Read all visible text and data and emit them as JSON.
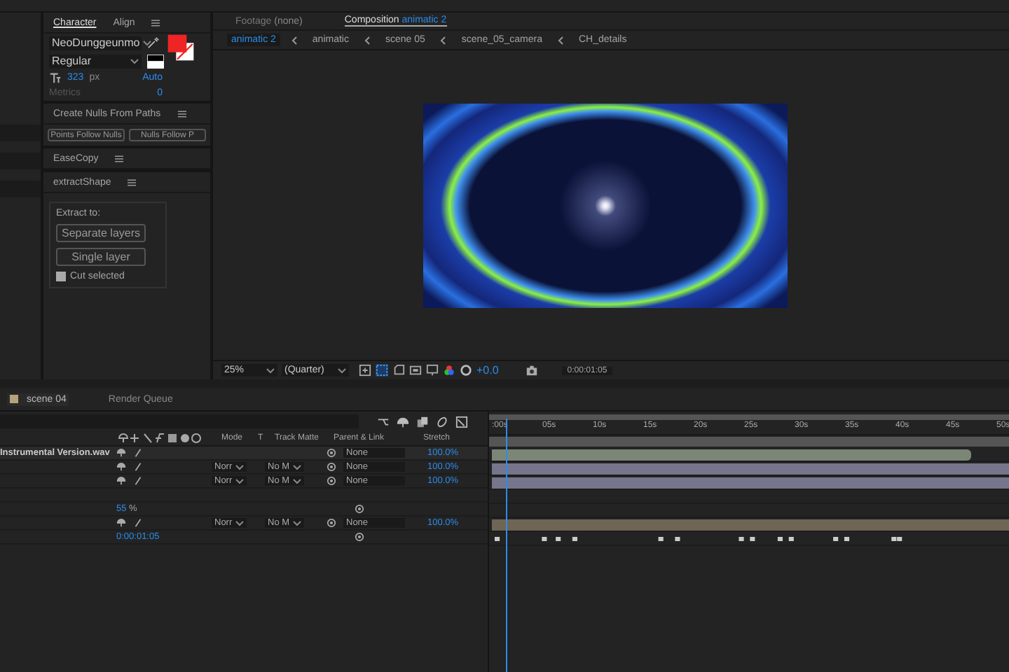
{
  "character_panel": {
    "tabs": [
      {
        "label": "Character",
        "selected": true
      },
      {
        "label": "Align",
        "selected": false
      }
    ],
    "font": "NeoDunggeunmo",
    "style": "Regular",
    "size": "323",
    "size_unit": "px",
    "leading": "Auto",
    "kerning": "Metrics",
    "tracking": "0"
  },
  "panels": [
    {
      "title": "Create Nulls From Paths",
      "buttons": [
        "Points Follow Nulls",
        "Nulls Follow P"
      ]
    },
    {
      "title": "EaseCopy"
    }
  ],
  "extract_panel": {
    "title": "extractShape",
    "group_label": "Extract to:",
    "buttons": [
      "Separate layers",
      "Single layer"
    ],
    "checkbox": {
      "label": "Cut selected",
      "checked": true
    }
  },
  "viewer": {
    "tabs": [
      {
        "prefix": "Footage",
        "name": "(none)",
        "selected": false
      },
      {
        "prefix": "Composition",
        "name": "animatic 2",
        "selected": true
      }
    ],
    "breadcrumbs": [
      {
        "label": "animatic 2",
        "selected": true
      },
      {
        "label": "animatic",
        "selected": false
      },
      {
        "label": "scene 05",
        "selected": false
      },
      {
        "label": "scene_05_camera",
        "selected": false
      },
      {
        "label": "CH_details",
        "selected": false
      }
    ],
    "zoom": "25%",
    "resolution": "(Quarter)",
    "exposure": "+0.0",
    "timecode": "0:00:01:05"
  },
  "timeline": {
    "tabs": [
      {
        "label": "scene 04",
        "selected": true
      },
      {
        "label": "Render Queue",
        "selected": false
      }
    ],
    "columns": [
      "Mode",
      "T",
      "Track Matte",
      "Parent & Link",
      "Stretch"
    ],
    "ticks": [
      ":00s",
      "05s",
      "10s",
      "15s",
      "20s",
      "25s",
      "30s",
      "35s",
      "40s",
      "45s",
      "50s"
    ],
    "rows": [
      {
        "kind": "audio",
        "name": "Instrumental Version.wav",
        "parent": "None",
        "stretch": "100.0%",
        "color": "#7b8676"
      },
      {
        "kind": "layer",
        "mode": "Norr",
        "matte": "No M",
        "parent": "None",
        "stretch": "100.0%",
        "color": "#75758c"
      },
      {
        "kind": "layer",
        "mode": "Norr",
        "matte": "No M",
        "parent": "None",
        "stretch": "100.0%",
        "color": "#75758c"
      },
      {
        "kind": "blank"
      },
      {
        "kind": "value",
        "value": "55",
        "unit": "%"
      },
      {
        "kind": "layer",
        "mode": "Norr",
        "matte": "No M",
        "parent": "None",
        "stretch": "100.0%",
        "color": "#6f6555"
      },
      {
        "kind": "time",
        "value": "0:00:01:05"
      }
    ]
  }
}
